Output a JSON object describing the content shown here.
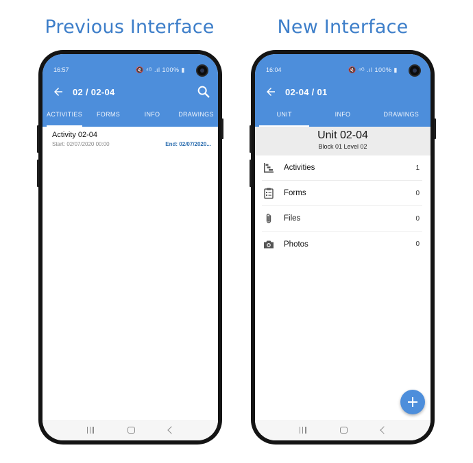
{
  "captions": {
    "left": "Previous Interface",
    "right": "New Interface"
  },
  "left": {
    "status": {
      "time": "16:57",
      "icons": "🔇 ⁴ᴳ .ıl 100% ▮"
    },
    "title": "02 / 02-04",
    "tabs": [
      "ACTIVITIES",
      "FORMS",
      "INFO",
      "DRAWINGS"
    ],
    "active_tab": 0,
    "activity": {
      "title": "Activity 02-04",
      "start": "Start: 02/07/2020 00:00",
      "end": "End: 02/07/2020..."
    }
  },
  "right": {
    "status": {
      "time": "16:04",
      "icons": "🔇 ⁴ᴳ .ıl 100% ▮"
    },
    "title": "02-04 / 01",
    "tabs": [
      "UNIT",
      "INFO",
      "DRAWINGS"
    ],
    "active_tab": 0,
    "unit": {
      "title": "Unit 02-04",
      "subtitle": "Block 01 Level 02"
    },
    "items": [
      {
        "label": "Activities",
        "count": "1",
        "icon": "gantt-icon"
      },
      {
        "label": "Forms",
        "count": "0",
        "icon": "clipboard-icon"
      },
      {
        "label": "Files",
        "count": "0",
        "icon": "paperclip-icon"
      },
      {
        "label": "Photos",
        "count": "0",
        "icon": "camera-icon"
      }
    ]
  },
  "colors": {
    "primary": "#4d8edb",
    "caption": "#3d7ec9",
    "end_date": "#2e6fb0"
  }
}
